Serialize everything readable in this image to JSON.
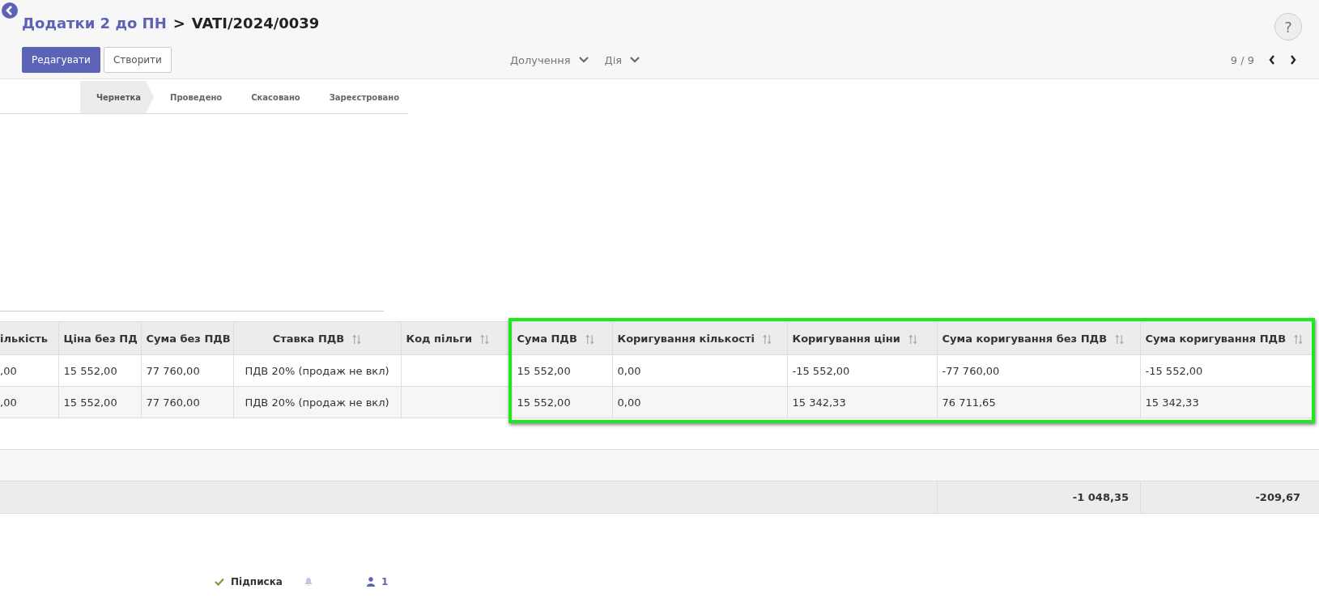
{
  "breadcrumb": {
    "parent": "Додатки 2 до ПН",
    "separator": ">",
    "current": "VATI/2024/0039"
  },
  "buttons": [
    {
      "label": "Редагувати",
      "kind": "primary"
    },
    {
      "label": "Створити",
      "kind": "secondary"
    }
  ],
  "menus": [
    {
      "label": "Долучення"
    },
    {
      "label": "Дія"
    }
  ],
  "help": {
    "label": "?"
  },
  "pager": {
    "label": "9 / 9"
  },
  "status_steps": [
    {
      "label": "Чернетка",
      "selected": true
    },
    {
      "label": "Проведено",
      "selected": false
    },
    {
      "label": "Скасовано",
      "selected": false
    },
    {
      "label": "Зареєстровано",
      "selected": false
    }
  ],
  "table": {
    "columns": [
      {
        "label": "ількість",
        "highlighted": false
      },
      {
        "label": "Ціна без ПД",
        "highlighted": false
      },
      {
        "label": "Сума без ПДВ",
        "highlighted": false
      },
      {
        "label": "Ставка ПДВ",
        "sortable": true,
        "highlighted": false
      },
      {
        "label": "Код пільги",
        "sortable": true,
        "highlighted": false
      },
      {
        "label": "Сума ПДВ",
        "sortable": true,
        "highlighted": true
      },
      {
        "label": "Коригування кількості",
        "sortable": true,
        "highlighted": true
      },
      {
        "label": "Коригування ціни",
        "sortable": true,
        "highlighted": true
      },
      {
        "label": "Сума коригування без ПДВ",
        "sortable": true,
        "highlighted": true
      },
      {
        "label": "Сума коригування ПДВ",
        "sortable": true,
        "highlighted": true
      }
    ],
    "rows": [
      [
        ",00",
        "15 552,00",
        "77 760,00",
        "ПДВ 20% (продаж не вкл)",
        "",
        "15 552,00",
        "0,00",
        "-15 552,00",
        "-77 760,00",
        "-15 552,00"
      ],
      [
        ",00",
        "15 552,00",
        "77 760,00",
        "ПДВ 20% (продаж не вкл)",
        "",
        "15 552,00",
        "0,00",
        "15 342,33",
        "76 711,65",
        "15 342,33"
      ]
    ],
    "totals": [
      "-1 048,35",
      "-209,67"
    ]
  },
  "followers": {
    "subscribe": "Підписка",
    "count": "1"
  }
}
